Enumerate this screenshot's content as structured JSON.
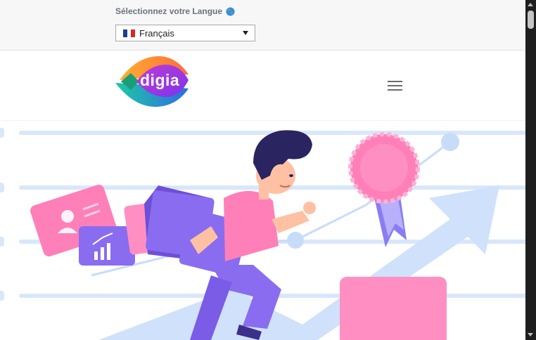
{
  "language_bar": {
    "label": "Sélectionnez votre Langue",
    "globe_icon": "globe-icon",
    "selected_language": "Français",
    "flag_icon": "france-flag-icon",
    "flag_colors": [
      "#1f3a93",
      "#ffffff",
      "#d62828"
    ]
  },
  "header": {
    "logo_text": "digia",
    "menu_icon": "hamburger-menu-icon"
  },
  "hero": {
    "illustration": "person-running-with-folders-growth-chart-illustration"
  },
  "colors": {
    "brand_purple": "#8e3fe0",
    "brand_pink": "#ff7fb8",
    "light_blue": "#cfe1fb",
    "violet": "#8a6cf0"
  }
}
